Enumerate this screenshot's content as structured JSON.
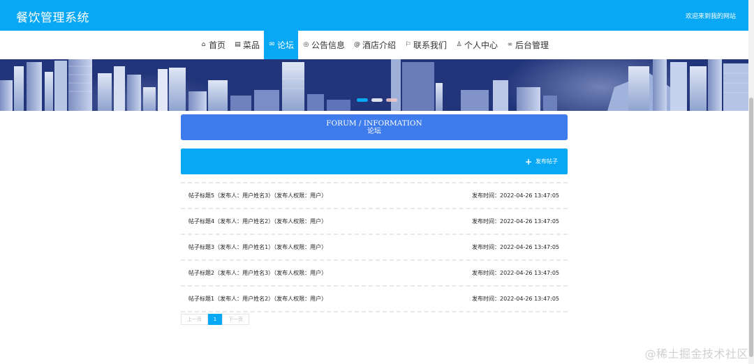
{
  "header": {
    "app_title": "餐饮管理系统",
    "welcome": "欢迎来到我的网站"
  },
  "nav": {
    "items": [
      {
        "label": "首页",
        "icon": "home-icon"
      },
      {
        "label": "菜品",
        "icon": "menu-icon"
      },
      {
        "label": "论坛",
        "icon": "forum-icon",
        "active": true
      },
      {
        "label": "公告信息",
        "icon": "notice-icon"
      },
      {
        "label": "酒店介绍",
        "icon": "hotel-icon"
      },
      {
        "label": "联系我们",
        "icon": "flag-icon"
      },
      {
        "label": "个人中心",
        "icon": "user-icon"
      },
      {
        "label": "后台管理",
        "icon": "link-icon"
      }
    ]
  },
  "section": {
    "title_en": "FORUM / INFORMATION",
    "title_cn": "论坛"
  },
  "action_bar": {
    "publish_label": "发布帖子"
  },
  "posts": [
    {
      "title": "帖子标题5（发布人：用户姓名3）（发布人权限：用户）",
      "time": "发布时间：2022-04-26 13:47:05"
    },
    {
      "title": "帖子标题4（发布人：用户姓名2）（发布人权限：用户）",
      "time": "发布时间：2022-04-26 13:47:05"
    },
    {
      "title": "帖子标题3（发布人：用户姓名1）（发布人权限：用户）",
      "time": "发布时间：2022-04-26 13:47:05"
    },
    {
      "title": "帖子标题2（发布人：用户姓名3）（发布人权限：用户）",
      "time": "发布时间：2022-04-26 13:47:05"
    },
    {
      "title": "帖子标题1（发布人：用户姓名2）（发布人权限：用户）",
      "time": "发布时间：2022-04-26 13:47:05"
    }
  ],
  "pagination": {
    "prev_label": "上一页",
    "current_page": "1",
    "next_label": "下一页"
  },
  "watermark": "@稀土掘金技术社区",
  "colors": {
    "primary": "#09a8f5",
    "title_bar": "#3e7bed"
  }
}
